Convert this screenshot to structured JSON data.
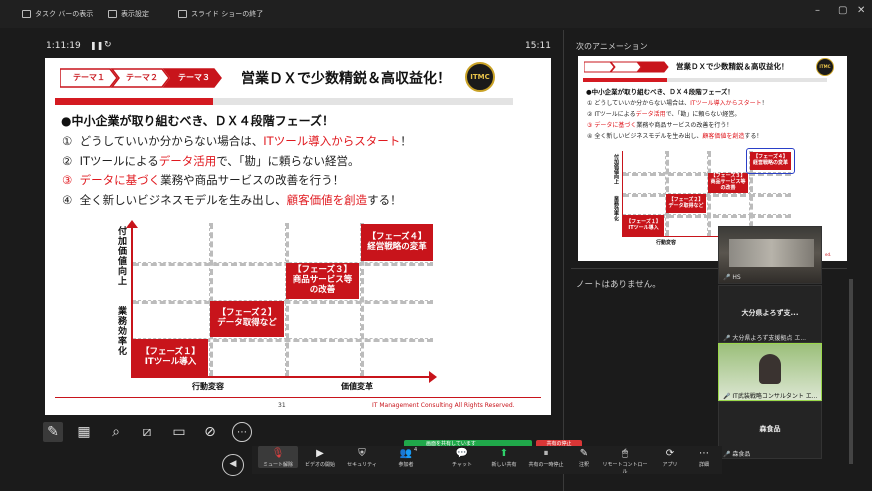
{
  "topbar": {
    "taskbar_label": "タスク バーの表示",
    "display_settings_label": "表示設定",
    "end_show_label": "スライド ショーの終了"
  },
  "presenter": {
    "elapsed": "1:11:19",
    "clock": "15:11",
    "next_animation_label": "次のアニメーション",
    "notes_empty": "ノートはありません。"
  },
  "slide": {
    "tabs": [
      "テーマ１",
      "テーマ２",
      "テーマ３"
    ],
    "title": "営業ＤＸで少数精鋭＆高収益化！",
    "logo_text": "ITMC",
    "heading": "●中小企業が取り組むべき、ＤＸ４段階フェーズ！",
    "items": [
      {
        "num": "①",
        "pre": "どうしていいか分からない場合は、",
        "red": "ITツール導入からスタート",
        "post": "！",
        "num_red": false
      },
      {
        "num": "②",
        "pre": "ITツールによる",
        "red": "データ活用",
        "post": "で、「勘」に頼らない経営。",
        "num_red": false
      },
      {
        "num": "③",
        "pre": "",
        "red": "データに基づく",
        "post": "業務や商品サービスの改善を行う！",
        "num_red": true
      },
      {
        "num": "④",
        "pre": "全く新しいビジネスモデルを生み出し、",
        "red": "顧客価値を創造",
        "post": "する！",
        "num_red": false
      }
    ],
    "y_label_top": "付加価値向上",
    "y_label_bottom": "業務効率化",
    "x_label_left": "行動変容",
    "x_label_right": "価値変革",
    "phases": [
      {
        "line1": "【フェーズ１】",
        "line2": "ITツール導入",
        "line3": ""
      },
      {
        "line1": "【フェーズ２】",
        "line2": "データ取得など",
        "line3": ""
      },
      {
        "line1": "【フェーズ３】",
        "line2": "商品サービス等",
        "line3": "の改善"
      },
      {
        "line1": "【フェーズ４】",
        "line2": "経営戦略の変革",
        "line3": ""
      }
    ],
    "page_number": "31",
    "footer": "IT Management Consulting All Rights Reserved."
  },
  "participants": [
    {
      "tile_label": "HS",
      "name": "大分県よろず支...",
      "footer": "大分県よろず支援拠点 エ..."
    },
    {
      "tile_label": "",
      "name": "",
      "footer": "IT武装戦略コンサルタント エ..."
    },
    {
      "tile_label": "",
      "name": "森食品",
      "footer": "森食品"
    }
  ],
  "share_bar": {
    "status": "画面を共有しています",
    "stop": "共有の停止"
  },
  "zoom_toolbar": {
    "items": [
      {
        "glyph": "🎙",
        "label": "ミュート解除"
      },
      {
        "glyph": "▶",
        "label": "ビデオの開始"
      },
      {
        "glyph": "⛨",
        "label": "セキュリティ"
      },
      {
        "glyph": "👥",
        "label": "参加者",
        "badge": "4"
      },
      {
        "glyph": "💬",
        "label": "チャット"
      },
      {
        "glyph": "⬆",
        "label": "新しい共有"
      },
      {
        "glyph": "⏸",
        "label": "共有の一時停止"
      },
      {
        "glyph": "✎",
        "label": "注釈"
      },
      {
        "glyph": "🖱",
        "label": "リモートコントロール"
      },
      {
        "glyph": "⟳",
        "label": "アプリ"
      },
      {
        "glyph": "⋯",
        "label": "詳細"
      }
    ]
  },
  "colors": {
    "accent_red": "#c8141b",
    "text_red": "#e0191f",
    "share_green": "#20a84a"
  }
}
